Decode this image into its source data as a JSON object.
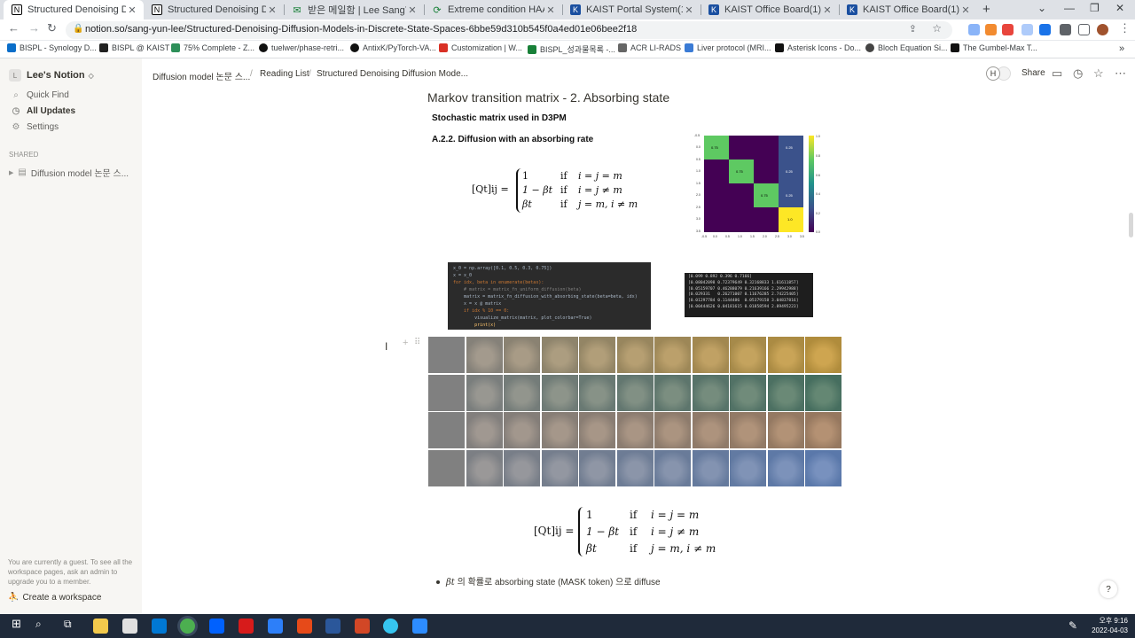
{
  "browser": {
    "tabs": [
      {
        "title": "Structured Denoising Diffusion",
        "favicon": "notion-icon",
        "active": true
      },
      {
        "title": "Structured Denoising Diffusion",
        "favicon": "notion-icon",
        "active": false
      },
      {
        "title": "받은 메일함 | Lee SangYun cor",
        "favicon": "mail-icon",
        "active": false
      },
      {
        "title": "Extreme condition HAADF-STE",
        "favicon": "link-icon",
        "active": false
      },
      {
        "title": "KAIST Portal System(1)",
        "favicon": "kaist-icon",
        "active": false
      },
      {
        "title": "KAIST Office Board(1)",
        "favicon": "kaist-icon",
        "active": false
      },
      {
        "title": "KAIST Office Board(1)",
        "favicon": "kaist-icon",
        "active": false
      }
    ],
    "url": "notion.so/sang-yun-lee/Structured-Denoising-Diffusion-Models-in-Discrete-State-Spaces-6bbe59d310b545f0a4ed01e06bee2f18",
    "bookmarks": [
      "BISPL - Synology D...",
      "BISPL @ KAIST",
      "75% Complete - Z...",
      "tuelwer/phase-retri...",
      "AntixK/PyTorch-VA...",
      "Customization | W...",
      "BISPL_성과물목록 -...",
      "ACR LI-RADS",
      "Liver protocol (MRI...",
      "Asterisk Icons - Do...",
      "Bloch Equation Si...",
      "The Gumbel-Max T..."
    ]
  },
  "sidebar": {
    "workspace": "Lee's Notion",
    "workspace_initial": "L",
    "items": [
      {
        "label": "Quick Find",
        "icon": "search-icon"
      },
      {
        "label": "All Updates",
        "icon": "clock-icon"
      },
      {
        "label": "Settings",
        "icon": "gear-icon"
      }
    ],
    "shared_heading": "SHARED",
    "shared_page": "Diffusion model 논문 스...",
    "guest_note": "You are currently a guest. To see all the workspace pages, ask an admin to upgrade you to a member.",
    "create_workspace": "Create a workspace"
  },
  "topbar": {
    "breadcrumbs": [
      "Diffusion model 논문 스...",
      "Reading List",
      "Structured Denoising Diffusion Mode..."
    ],
    "user_initial": "H",
    "share_label": "Share"
  },
  "content": {
    "title": "Markov transition matrix - 2. Absorbing state",
    "label1": "Stochastic matrix used in D3PM",
    "label2": "A.2.2. Diffusion with an absorbing rate",
    "eq_lhs": "[Qt]ij =",
    "eq_rows": [
      {
        "val": "1",
        "cond": "if",
        "expr": "i = j = m"
      },
      {
        "val": "1 − βt",
        "cond": "if",
        "expr": "i = j ≠ m"
      },
      {
        "val": "βt",
        "cond": "if",
        "expr": "j = m, i ≠ m"
      }
    ],
    "heatmap": {
      "labels": [
        "0.75",
        "0.75",
        "0.75",
        "1.0",
        "0.25",
        "0.25",
        "0.25"
      ],
      "colorbar_ticks": [
        "1.0",
        "0.8",
        "0.6",
        "0.4",
        "0.2",
        "0.0"
      ],
      "y_ticks": [
        "-0.5",
        "0.0",
        "0.5",
        "1.0",
        "1.5",
        "2.0",
        "2.5",
        "3.0",
        "3.5"
      ],
      "x_ticks": [
        "-0.5",
        "0.0",
        "0.5",
        "1.0",
        "1.5",
        "2.0",
        "2.5",
        "3.0",
        "3.5"
      ]
    },
    "code_lines": [
      "x_0 = np.array([0.1, 0.5, 0.3, 0.75])",
      "x = x_0",
      "for idx, beta in enumerate(betas):",
      "    # matrix = matrix_fn_uniform_diffusion(beta)",
      "    matrix = matrix_fn_diffusion_with_absorbing_state(beta=beta, idx)",
      "    x = x @ matrix",
      "    if idx % 10 == 0:",
      "        visualize_matrix(matrix, plot_colorbar=True)",
      "        print(x)"
    ],
    "output_lines": [
      "[0.099 0.892 0.396 0.7166]",
      "[0.08042098 0.72379649 0.32168833 1.61611857]",
      "[0.05159707 0.46288079 0.21639166 2.29942988]",
      "[0.029331   0.26271007 0.11676285 2.74225405]",
      "[0.01297784 0.1144486  0.05379158 3.04837816]",
      "[0.00444626 0.04181615 0.01858594 2.89495223]"
    ],
    "grid_rows": 4,
    "grid_cols": 11,
    "eq2_lhs": "[Qt]ij =",
    "bullet_beta": "βt",
    "bullet_text": " 의 확률로 absorbing state (MASK token) 으로 diffuse"
  },
  "help_label": "?",
  "taskbar": {
    "time_ampm": "오후 9:16",
    "date": "2022-04-03"
  }
}
